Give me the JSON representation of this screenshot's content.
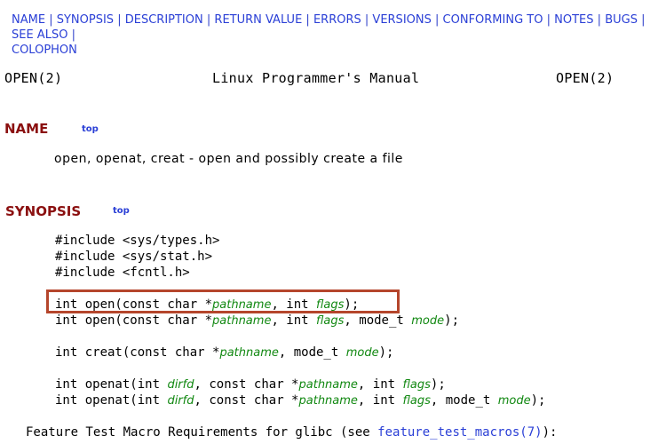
{
  "nav": {
    "links": [
      "NAME",
      "SYNOPSIS",
      "DESCRIPTION",
      "RETURN VALUE",
      "ERRORS",
      "VERSIONS",
      "CONFORMING TO",
      "NOTES",
      "BUGS",
      "SEE ALSO",
      "COLOPHON"
    ],
    "separator": "|"
  },
  "header": {
    "left": "OPEN(2)",
    "center": "Linux Programmer's Manual",
    "right": "OPEN(2)"
  },
  "sections": {
    "name": {
      "title": "NAME",
      "top": "top",
      "text": "open, openat, creat - open and possibly create a file"
    },
    "synopsis": {
      "title": "SYNOPSIS",
      "top": "top",
      "includes": [
        "#include <sys/types.h>",
        "#include <sys/stat.h>",
        "#include <fcntl.h>"
      ],
      "prototypes": [
        [
          [
            "int open(const char *",
            0
          ],
          [
            "pathname",
            1
          ],
          [
            ", int ",
            0
          ],
          [
            "flags",
            1
          ],
          [
            ");",
            0
          ]
        ],
        [
          [
            "int open(const char *",
            0
          ],
          [
            "pathname",
            1
          ],
          [
            ", int ",
            0
          ],
          [
            "flags",
            1
          ],
          [
            ", mode_t ",
            0
          ],
          [
            "mode",
            1
          ],
          [
            ");",
            0
          ]
        ],
        [
          [
            "int creat(const char *",
            0
          ],
          [
            "pathname",
            1
          ],
          [
            ", mode_t ",
            0
          ],
          [
            "mode",
            1
          ],
          [
            ");",
            0
          ]
        ],
        [
          [
            "int openat(int ",
            0
          ],
          [
            "dirfd",
            1
          ],
          [
            ", const char *",
            0
          ],
          [
            "pathname",
            1
          ],
          [
            ", int ",
            0
          ],
          [
            "flags",
            1
          ],
          [
            ");",
            0
          ]
        ],
        [
          [
            "int openat(int ",
            0
          ],
          [
            "dirfd",
            1
          ],
          [
            ", const char *",
            0
          ],
          [
            "pathname",
            1
          ],
          [
            ", int ",
            0
          ],
          [
            "flags",
            1
          ],
          [
            ", mode_t ",
            0
          ],
          [
            "mode",
            1
          ],
          [
            ");",
            0
          ]
        ]
      ]
    }
  },
  "footer": {
    "prefix": "Feature Test Macro Requirements for glibc (see ",
    "link": "feature_test_macros(7)",
    "suffix": "):"
  },
  "colors": {
    "link": "#2a3fd6",
    "heading": "#8b1010",
    "argument": "#118811",
    "highlight": "#b5462c"
  }
}
